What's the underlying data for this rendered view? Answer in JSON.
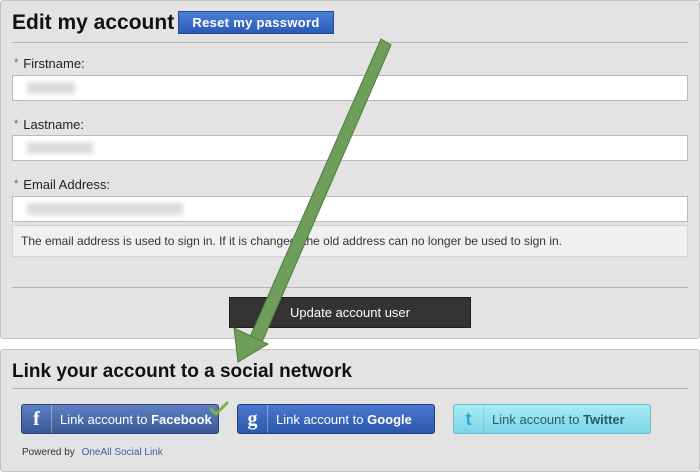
{
  "account": {
    "title": "Edit my account",
    "reset_password_label": "Reset my password",
    "firstname_label": "Firstname:",
    "lastname_label": "Lastname:",
    "email_label": "Email Address:",
    "required_marker": "*",
    "email_help": "The email address is used to sign in. If it is changed, the old address can no longer be used to sign in.",
    "update_label": "Update account user"
  },
  "social": {
    "title": "Link your account to a social network",
    "facebook": {
      "prefix": "Link account to",
      "network": "Facebook",
      "icon": "f"
    },
    "google": {
      "prefix": "Link account to",
      "network": "Google",
      "icon": "g"
    },
    "twitter": {
      "prefix": "Link account to",
      "network": "Twitter",
      "icon": "t"
    },
    "powered_by_label": "Powered by",
    "powered_by_link": "OneAll Social Link"
  },
  "colors": {
    "facebook": "#3b5998",
    "google": "#2c57ad",
    "twitter": "#7ad7e6",
    "arrow": "#6e9e5a",
    "check": "#7cb342"
  }
}
